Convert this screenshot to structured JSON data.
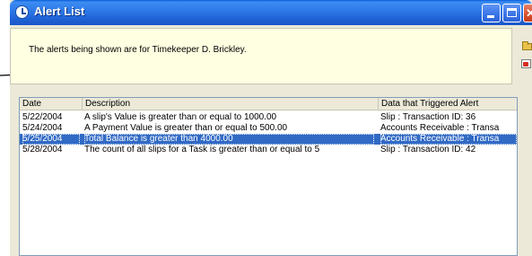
{
  "window": {
    "title": "Alert List"
  },
  "banner": {
    "text": "The alerts being shown are for Timekeeper D. Brickley."
  },
  "columns": [
    "Date",
    "Description",
    "Data that Triggered Alert"
  ],
  "rows": [
    {
      "date": "5/22/2004",
      "description": "A slip's Value is greater than or equal to 1000.00",
      "trigger": "Slip : Transaction ID: 36",
      "selected": false
    },
    {
      "date": "5/24/2004",
      "description": "A Payment Value is greater than or equal to 500.00",
      "trigger": "Accounts Receivable : Transa",
      "selected": false
    },
    {
      "date": "5/25/2004",
      "description": "Total Balance is greater than 4000.00",
      "trigger": "Accounts Receivable : Transa",
      "selected": true
    },
    {
      "date": "5/28/2004",
      "description": "The count of all slips for a Task is greater than or equal to 5",
      "trigger": "Slip : Transaction ID: 42",
      "selected": false
    }
  ],
  "colors": {
    "titlebar": "#2f7ae9",
    "banner_bg": "#ffffe1",
    "selection": "#316ac5"
  },
  "icons": [
    "clock-icon",
    "minimize-icon",
    "maximize-icon",
    "close-icon",
    "folder-icon",
    "export-icon"
  ]
}
